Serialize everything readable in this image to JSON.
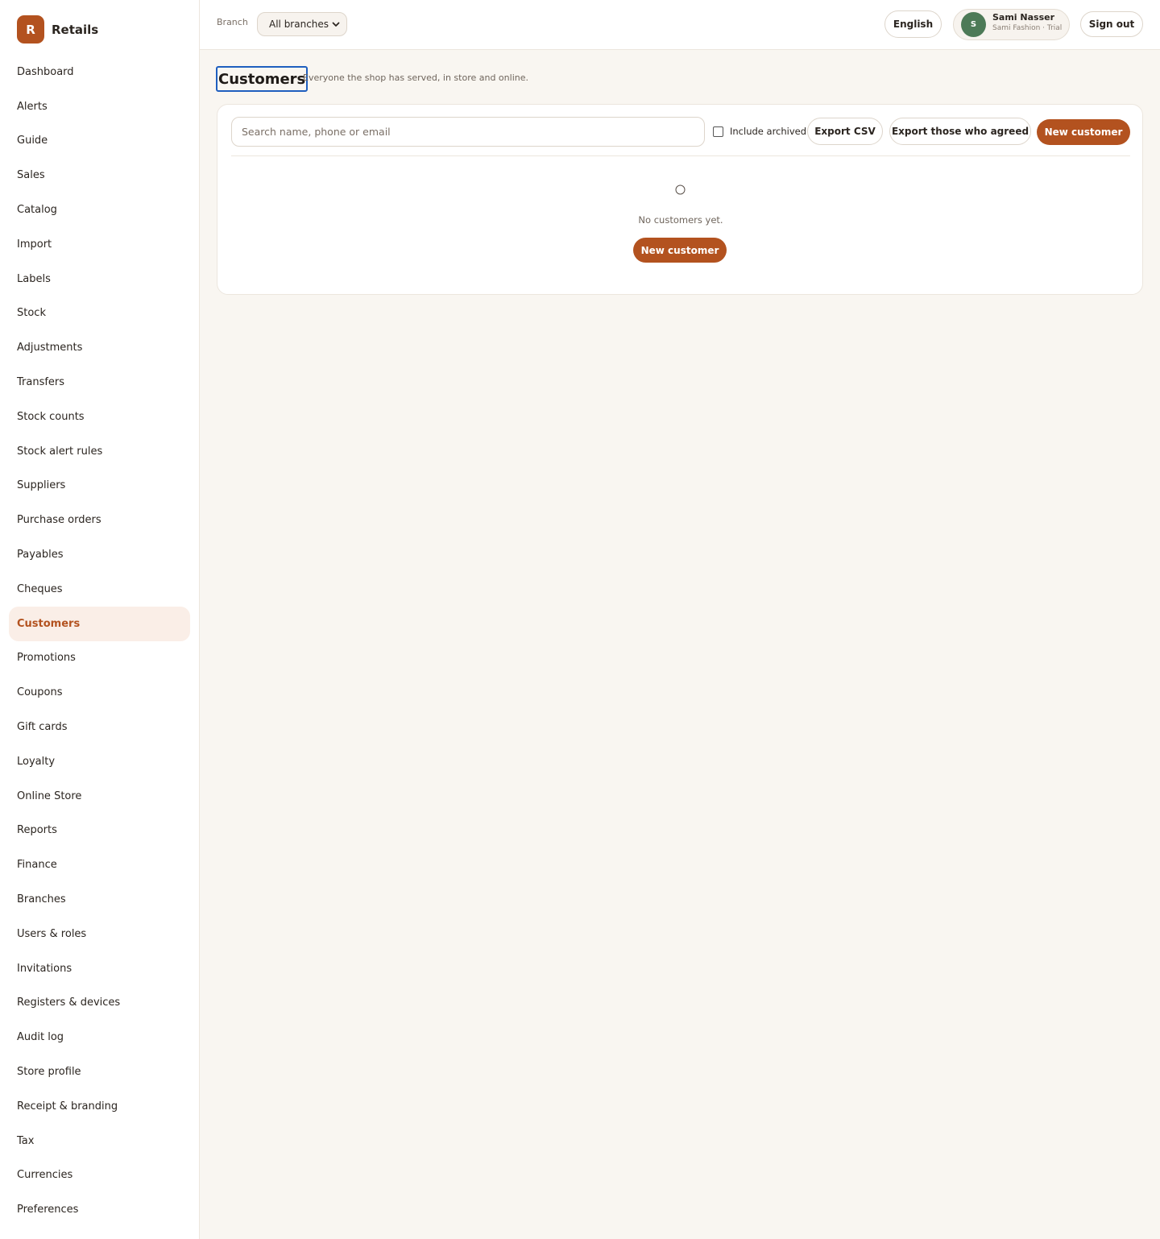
{
  "brand": {
    "mark": "R",
    "name": "Retails"
  },
  "sidebar": {
    "items": [
      {
        "label": "Dashboard",
        "active": false
      },
      {
        "label": "Alerts",
        "active": false
      },
      {
        "label": "Guide",
        "active": false
      },
      {
        "label": "Sales",
        "active": false
      },
      {
        "label": "Catalog",
        "active": false
      },
      {
        "label": "Import",
        "active": false
      },
      {
        "label": "Labels",
        "active": false
      },
      {
        "label": "Stock",
        "active": false
      },
      {
        "label": "Adjustments",
        "active": false
      },
      {
        "label": "Transfers",
        "active": false
      },
      {
        "label": "Stock counts",
        "active": false
      },
      {
        "label": "Stock alert rules",
        "active": false
      },
      {
        "label": "Suppliers",
        "active": false
      },
      {
        "label": "Purchase orders",
        "active": false
      },
      {
        "label": "Payables",
        "active": false
      },
      {
        "label": "Cheques",
        "active": false
      },
      {
        "label": "Customers",
        "active": true
      },
      {
        "label": "Promotions",
        "active": false
      },
      {
        "label": "Coupons",
        "active": false
      },
      {
        "label": "Gift cards",
        "active": false
      },
      {
        "label": "Loyalty",
        "active": false
      },
      {
        "label": "Online Store",
        "active": false
      },
      {
        "label": "Reports",
        "active": false
      },
      {
        "label": "Finance",
        "active": false
      },
      {
        "label": "Branches",
        "active": false
      },
      {
        "label": "Users & roles",
        "active": false
      },
      {
        "label": "Invitations",
        "active": false
      },
      {
        "label": "Registers & devices",
        "active": false
      },
      {
        "label": "Audit log",
        "active": false
      },
      {
        "label": "Store profile",
        "active": false
      },
      {
        "label": "Receipt & branding",
        "active": false
      },
      {
        "label": "Tax",
        "active": false
      },
      {
        "label": "Currencies",
        "active": false
      },
      {
        "label": "Preferences",
        "active": false
      }
    ]
  },
  "topbar": {
    "branch_label": "Branch",
    "branch_value": "All branches",
    "language": "English",
    "user": {
      "initial": "S",
      "name": "Sami Nasser",
      "subtitle": "Sami Fashion · Trial"
    },
    "sign_out": "Sign out"
  },
  "page": {
    "title": "Customers",
    "subtitle": "Everyone the shop has served, in store and online."
  },
  "toolbar": {
    "search_placeholder": "Search name, phone or email",
    "search_value": "",
    "include_archived_label": "Include archived",
    "include_archived_checked": false,
    "export_csv": "Export CSV",
    "export_agreed": "Export those who agreed",
    "new_customer": "New customer"
  },
  "empty_state": {
    "message": "No customers yet.",
    "new_customer": "New customer"
  },
  "colors": {
    "accent": "#b3521f",
    "active_bg": "#faeee7",
    "page_bg": "#f9f6f1",
    "avatar": "#4d7a57",
    "focus_ring": "#1f5fbf"
  },
  "icons": {
    "branch_dropdown": "chevron-down-icon",
    "empty_state": "circle-icon"
  }
}
